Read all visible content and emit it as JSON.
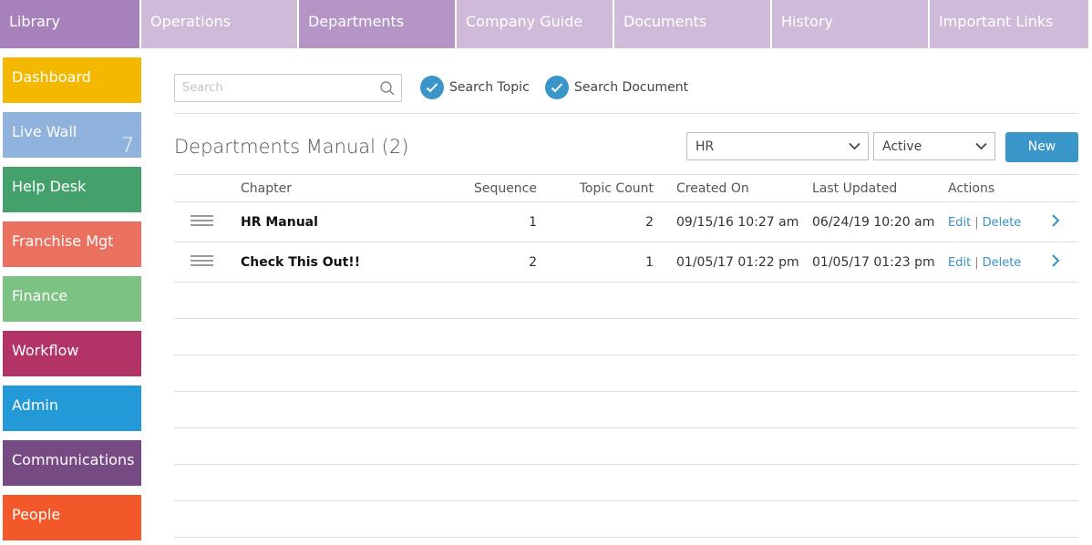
{
  "top_nav": {
    "library": "Library",
    "tabs": [
      {
        "label": "Operations"
      },
      {
        "label": "Departments"
      },
      {
        "label": "Company Guide"
      },
      {
        "label": "Documents"
      },
      {
        "label": "History"
      },
      {
        "label": "Important Links"
      }
    ],
    "active_tab": "Departments"
  },
  "sidebar": {
    "items": [
      {
        "label": "Dashboard",
        "color": "#f5b800"
      },
      {
        "label": "Live Wall",
        "color": "#8fb3dd",
        "badge": "7"
      },
      {
        "label": "Help Desk",
        "color": "#45a16b"
      },
      {
        "label": "Franchise Mgt",
        "color": "#ea7060"
      },
      {
        "label": "Finance",
        "color": "#7cc283"
      },
      {
        "label": "Workflow",
        "color": "#b23466"
      },
      {
        "label": "Admin",
        "color": "#2499d8"
      },
      {
        "label": "Communications",
        "color": "#764a82"
      },
      {
        "label": "People",
        "color": "#f2582a"
      }
    ]
  },
  "search": {
    "placeholder": "Search",
    "value": "",
    "search_topic_label": "Search Topic",
    "search_document_label": "Search Document"
  },
  "page": {
    "title": "Departments Manual (2)",
    "department_select": "HR",
    "status_select": "Active",
    "new_label": "New"
  },
  "table": {
    "headers": {
      "chapter": "Chapter",
      "sequence": "Sequence",
      "topic_count": "Topic Count",
      "created_on": "Created On",
      "last_updated": "Last Updated",
      "actions": "Actions"
    },
    "rows": [
      {
        "chapter": "HR Manual",
        "sequence": "1",
        "topic_count": "2",
        "created_on": "09/15/16 10:27 am",
        "last_updated": "06/24/19 10:20 am",
        "edit": "Edit",
        "delete": "Delete"
      },
      {
        "chapter": "Check This Out!!",
        "sequence": "2",
        "topic_count": "1",
        "created_on": "01/05/17 01:22 pm",
        "last_updated": "01/05/17 01:23 pm",
        "edit": "Edit",
        "delete": "Delete"
      }
    ]
  },
  "colors": {
    "accent": "#3a95c9",
    "nav_library": "#a782ba",
    "nav_tab": "#cfbad9",
    "nav_active": "#b495c5"
  }
}
